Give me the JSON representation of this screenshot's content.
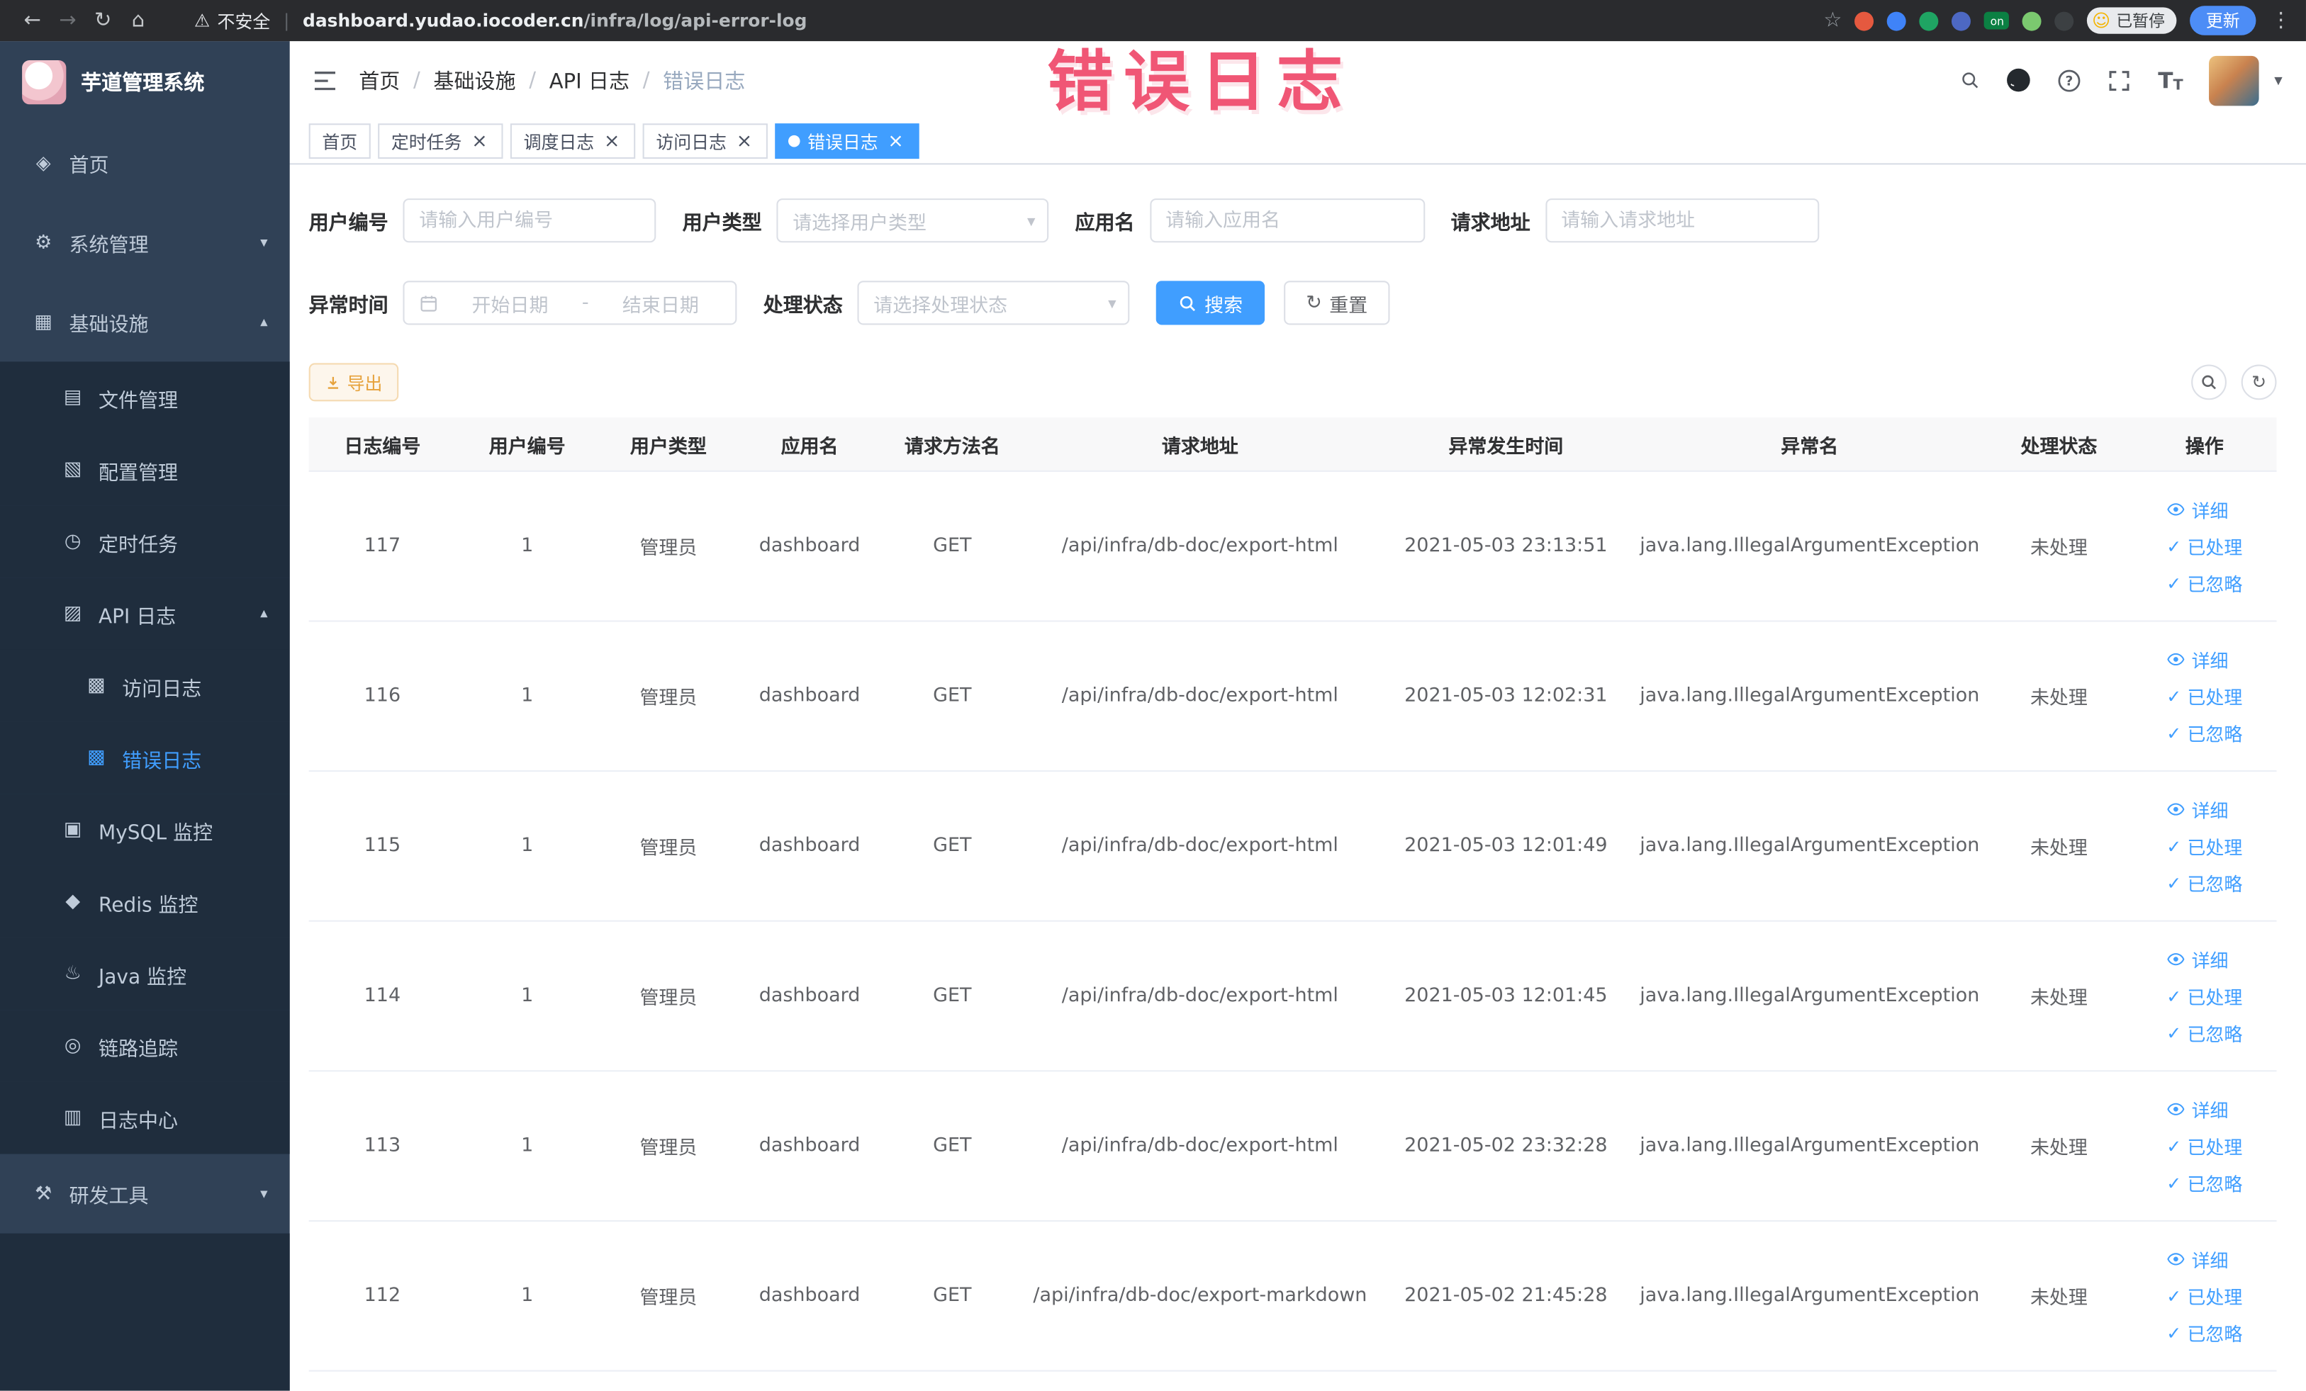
{
  "browser": {
    "security_label": "不安全",
    "url_host": "dashboard.yudao.iocoder.cn",
    "url_path": "/infra/log/api-error-log",
    "paused_badge": "已暂停",
    "update_button": "更新"
  },
  "annotation": {
    "text": "错误日志",
    "color": "#ee3f63"
  },
  "sidebar": {
    "logo_title": "芋道管理系统",
    "items": [
      {
        "name": "home",
        "label": "首页",
        "icon": "guide-icon",
        "level": 1
      },
      {
        "name": "system",
        "label": "系统管理",
        "icon": "gear-icon",
        "level": 1,
        "chevron": "down"
      },
      {
        "name": "infra",
        "label": "基础设施",
        "icon": "infra-icon",
        "level": 1,
        "chevron": "up"
      },
      {
        "name": "file",
        "label": "文件管理",
        "icon": "file-icon",
        "level": 2,
        "group": true
      },
      {
        "name": "config",
        "label": "配置管理",
        "icon": "config-icon",
        "level": 2,
        "group": true
      },
      {
        "name": "job",
        "label": "定时任务",
        "icon": "job-icon",
        "level": 2,
        "group": true
      },
      {
        "name": "api-log",
        "label": "API 日志",
        "icon": "api-log-icon",
        "level": 2,
        "chevron": "up",
        "group": true
      },
      {
        "name": "access-log",
        "label": "访问日志",
        "icon": "log-icon",
        "level": 3,
        "group": true
      },
      {
        "name": "error-log",
        "label": "错误日志",
        "icon": "log-icon",
        "level": 3,
        "group": true,
        "active": true
      },
      {
        "name": "mysql",
        "label": "MySQL 监控",
        "icon": "mysql-icon",
        "level": 2,
        "group": true
      },
      {
        "name": "redis",
        "label": "Redis 监控",
        "icon": "redis-icon",
        "level": 2,
        "group": true
      },
      {
        "name": "java",
        "label": "Java 监控",
        "icon": "java-icon",
        "level": 2,
        "group": true
      },
      {
        "name": "trace",
        "label": "链路追踪",
        "icon": "trace-icon",
        "level": 2,
        "group": true
      },
      {
        "name": "log-center",
        "label": "日志中心",
        "icon": "log-center-icon",
        "level": 2,
        "group": true
      },
      {
        "name": "dev-tools",
        "label": "研发工具",
        "icon": "tool-icon",
        "level": 1,
        "chevron": "down"
      }
    ]
  },
  "header": {
    "breadcrumb": [
      "首页",
      "基础设施",
      "API 日志",
      "错误日志"
    ]
  },
  "tabs": [
    {
      "name": "home",
      "label": "首页",
      "closable": false,
      "active": false
    },
    {
      "name": "job",
      "label": "定时任务",
      "closable": true,
      "active": false
    },
    {
      "name": "job-log",
      "label": "调度日志",
      "closable": true,
      "active": false
    },
    {
      "name": "access-log",
      "label": "访问日志",
      "closable": true,
      "active": false
    },
    {
      "name": "error-log",
      "label": "错误日志",
      "closable": true,
      "active": true
    }
  ],
  "filters": {
    "user_id": {
      "label": "用户编号",
      "placeholder": "请输入用户编号"
    },
    "user_type": {
      "label": "用户类型",
      "placeholder": "请选择用户类型"
    },
    "app_name": {
      "label": "应用名",
      "placeholder": "请输入应用名"
    },
    "request_url": {
      "label": "请求地址",
      "placeholder": "请输入请求地址"
    },
    "exception_time": {
      "label": "异常时间",
      "start_placeholder": "开始日期",
      "separator": "-",
      "end_placeholder": "结束日期"
    },
    "process_status": {
      "label": "处理状态",
      "placeholder": "请选择处理状态"
    },
    "search_label": "搜索",
    "reset_label": "重置"
  },
  "toolbar": {
    "export_label": "导出"
  },
  "table": {
    "columns": [
      "日志编号",
      "用户编号",
      "用户类型",
      "应用名",
      "请求方法名",
      "请求地址",
      "异常发生时间",
      "异常名",
      "处理状态",
      "操作"
    ],
    "actions": {
      "detail": "详细",
      "process": "已处理",
      "ignore": "已忽略"
    },
    "rows": [
      {
        "id": "117",
        "user_id": "1",
        "user_type": "管理员",
        "app": "dashboard",
        "method": "GET",
        "url": "/api/infra/db-doc/export-html",
        "time": "2021-05-03 23:13:51",
        "exception": "java.lang.IllegalArgumentException",
        "status": "未处理"
      },
      {
        "id": "116",
        "user_id": "1",
        "user_type": "管理员",
        "app": "dashboard",
        "method": "GET",
        "url": "/api/infra/db-doc/export-html",
        "time": "2021-05-03 12:02:31",
        "exception": "java.lang.IllegalArgumentException",
        "status": "未处理"
      },
      {
        "id": "115",
        "user_id": "1",
        "user_type": "管理员",
        "app": "dashboard",
        "method": "GET",
        "url": "/api/infra/db-doc/export-html",
        "time": "2021-05-03 12:01:49",
        "exception": "java.lang.IllegalArgumentException",
        "status": "未处理"
      },
      {
        "id": "114",
        "user_id": "1",
        "user_type": "管理员",
        "app": "dashboard",
        "method": "GET",
        "url": "/api/infra/db-doc/export-html",
        "time": "2021-05-03 12:01:45",
        "exception": "java.lang.IllegalArgumentException",
        "status": "未处理"
      },
      {
        "id": "113",
        "user_id": "1",
        "user_type": "管理员",
        "app": "dashboard",
        "method": "GET",
        "url": "/api/infra/db-doc/export-html",
        "time": "2021-05-02 23:32:28",
        "exception": "java.lang.IllegalArgumentException",
        "status": "未处理"
      },
      {
        "id": "112",
        "user_id": "1",
        "user_type": "管理员",
        "app": "dashboard",
        "method": "GET",
        "url": "/api/infra/db-doc/export-markdown",
        "time": "2021-05-02 21:45:28",
        "exception": "java.lang.IllegalArgumentException",
        "status": "未处理"
      }
    ]
  },
  "colors": {
    "primary": "#409eff",
    "warning": "#e6a23c",
    "sidebar": "#304156",
    "sidebar_submenu": "#1f2d3d"
  }
}
